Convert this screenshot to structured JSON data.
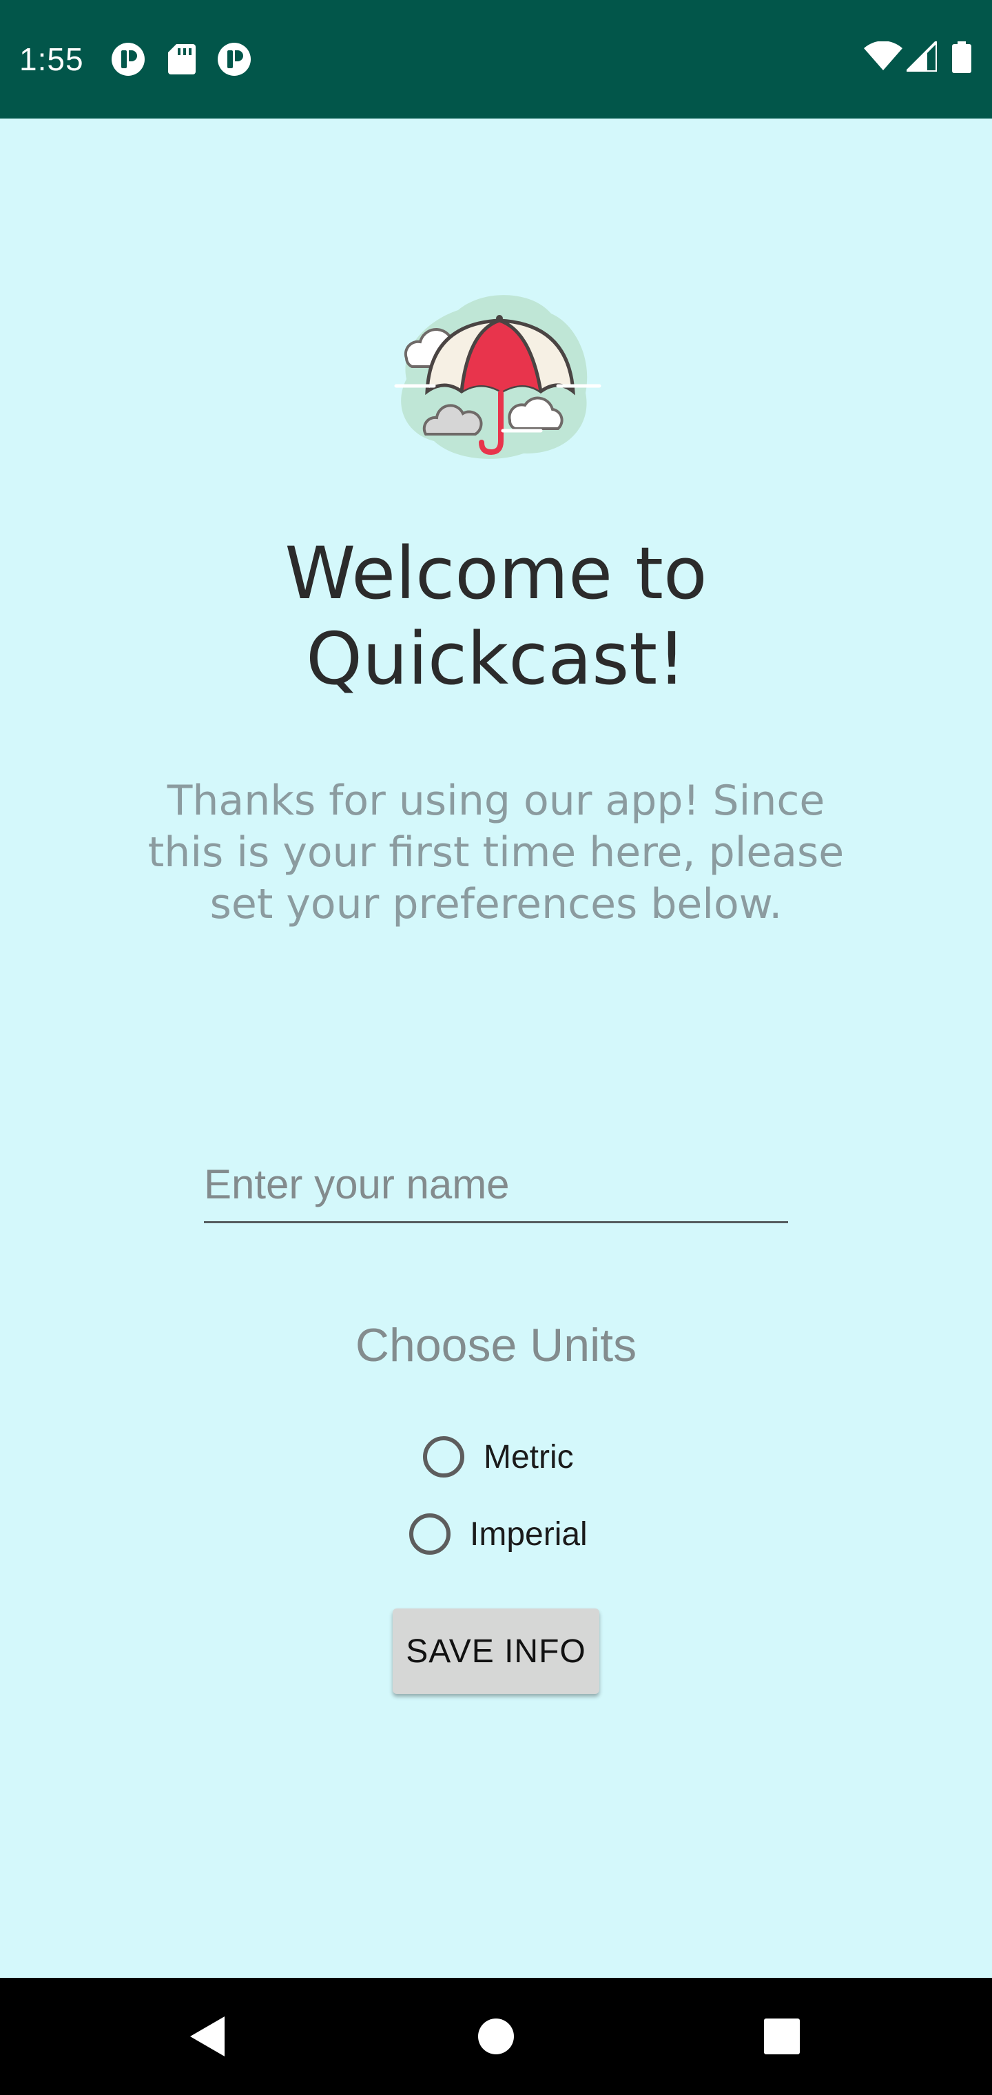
{
  "status_bar": {
    "time": "1:55",
    "left_icons": [
      "notification-badge-icon",
      "sd-card-icon",
      "notification-badge-icon"
    ],
    "right_icons": [
      "wifi-icon",
      "cellular-signal-icon",
      "battery-icon"
    ],
    "background_color": "#02564a"
  },
  "app": {
    "background_color": "#d4f8fb",
    "logo_icon": "umbrella-clouds-icon",
    "welcome_title": "Welcome to\nQuickcast!",
    "subtitle": "Thanks for using our app! Since\nthis is your first time here, please\nset your preferences below.",
    "name_input": {
      "placeholder": "Enter your name",
      "value": ""
    },
    "units_heading": "Choose Units",
    "units_options": [
      {
        "label": "Metric",
        "selected": false
      },
      {
        "label": "Imperial",
        "selected": false
      }
    ],
    "save_button_label": "SAVE INFO"
  },
  "nav_bar": {
    "buttons": [
      "back-icon",
      "home-icon",
      "recents-icon"
    ]
  }
}
